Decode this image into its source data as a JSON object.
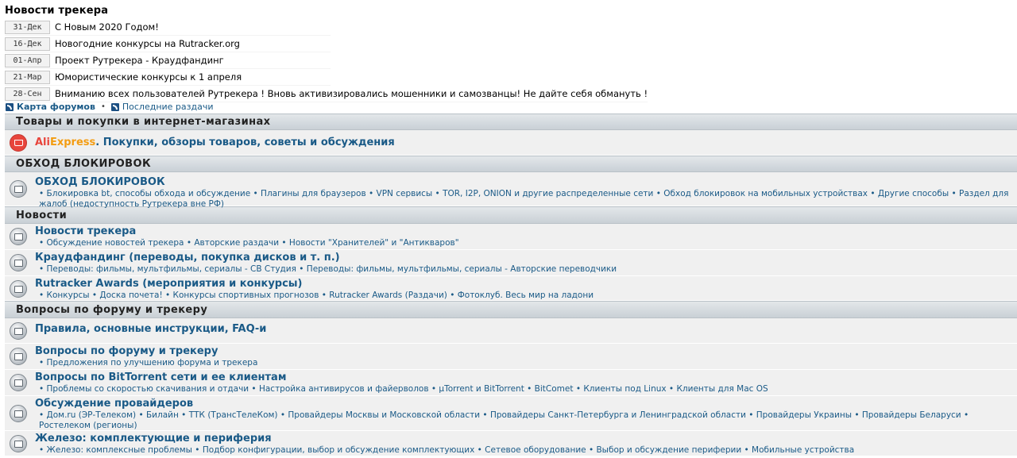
{
  "news": {
    "title": "Новости трекера",
    "items": [
      {
        "date": "31-Дек",
        "text": "С Новым 2020 Годом!"
      },
      {
        "date": "16-Дек",
        "text": "Новогодние конкурсы на Rutracker.org"
      },
      {
        "date": "01-Апр",
        "text": "Проект Рутрекера - Краудфандинг"
      },
      {
        "date": "21-Мар",
        "text": "Юмористические конкурсы к 1 апреля"
      },
      {
        "date": "28-Сен",
        "text": "Вниманию всех пользователей Рутрекера ! Вновь активизировались мошенники и самозванцы! Не дайте себя обмануть !"
      }
    ]
  },
  "links": {
    "forum_map": "Карта форумов",
    "separator": "•",
    "recent": "Последние раздачи"
  },
  "categories": [
    {
      "title": "Товары и покупки в интернет-магазинах",
      "forums": [
        {
          "brand_a": "Ali",
          "brand_b": "Express",
          "title": ". Покупки, обзоры товаров, советы и обсуждения",
          "sub": ""
        }
      ]
    },
    {
      "title": "ОБХОД БЛОКИРОВОК",
      "forums": [
        {
          "title": "ОБХОД БЛОКИРОВОК",
          "sub": "• Блокировка bt, способы обхода и обсуждение • Плагины для браузеров • VPN сервисы • TOR, I2P, ONION и другие распределенные сети • Обход блокировок на мобильных устройствах • Другие способы • Раздел для жалоб (недоступность Рутрекера вне РФ)"
        }
      ]
    },
    {
      "title": "Новости",
      "forums": [
        {
          "title": "Новости трекера",
          "sub": "• Обсуждение новостей трекера • Авторские раздачи • Новости \"Хранителей\" и \"Антикваров\""
        },
        {
          "title": "Краудфандинг (переводы, покупка дисков и т. п.)",
          "sub": "• Переводы: фильмы, мультфильмы, сериалы - СВ Студия • Переводы: фильмы, мультфильмы, сериалы - Авторские переводчики"
        },
        {
          "title": "Rutracker Awards (мероприятия и конкурсы)",
          "sub": "• Конкурсы • Доска почета! • Конкурсы спортивных прогнозов • Rutracker Awards (Раздачи) • Фотоклуб. Весь мир на ладони"
        }
      ]
    },
    {
      "title": "Вопросы по форуму и трекеру",
      "forums": [
        {
          "title": "Правила, основные инструкции, FAQ-и",
          "sub": ""
        },
        {
          "title": "Вопросы по форуму и трекеру",
          "sub": "• Предложения по улучшению форума и трекера"
        },
        {
          "title": "Вопросы по BitTorrent сети и ее клиентам",
          "sub": "• Проблемы со скоростью скачивания и отдачи • Настройка антивирусов и файерволов • µTorrent и BitTorrent • BitComet • Клиенты под Linux • Клиенты для Mac OS"
        },
        {
          "title": "Обсуждение провайдеров",
          "sub": "• Дом.ru (ЭР-Телеком) • Билайн • ТТК (ТрансТелеКом) • Провайдеры Москвы и Московской области • Провайдеры Санкт-Петербурга и Ленинградской области • Провайдеры Украины • Провайдеры Беларуси • Ростелеком (регионы)"
        },
        {
          "title": "Железо: комплектующие и периферия",
          "sub": "• Железо: комплексные проблемы • Подбор конфигурации, выбор и обсуждение комплектующих • Сетевое оборудование • Выбор и обсуждение периферии • Мобильные устройства"
        }
      ]
    }
  ]
}
